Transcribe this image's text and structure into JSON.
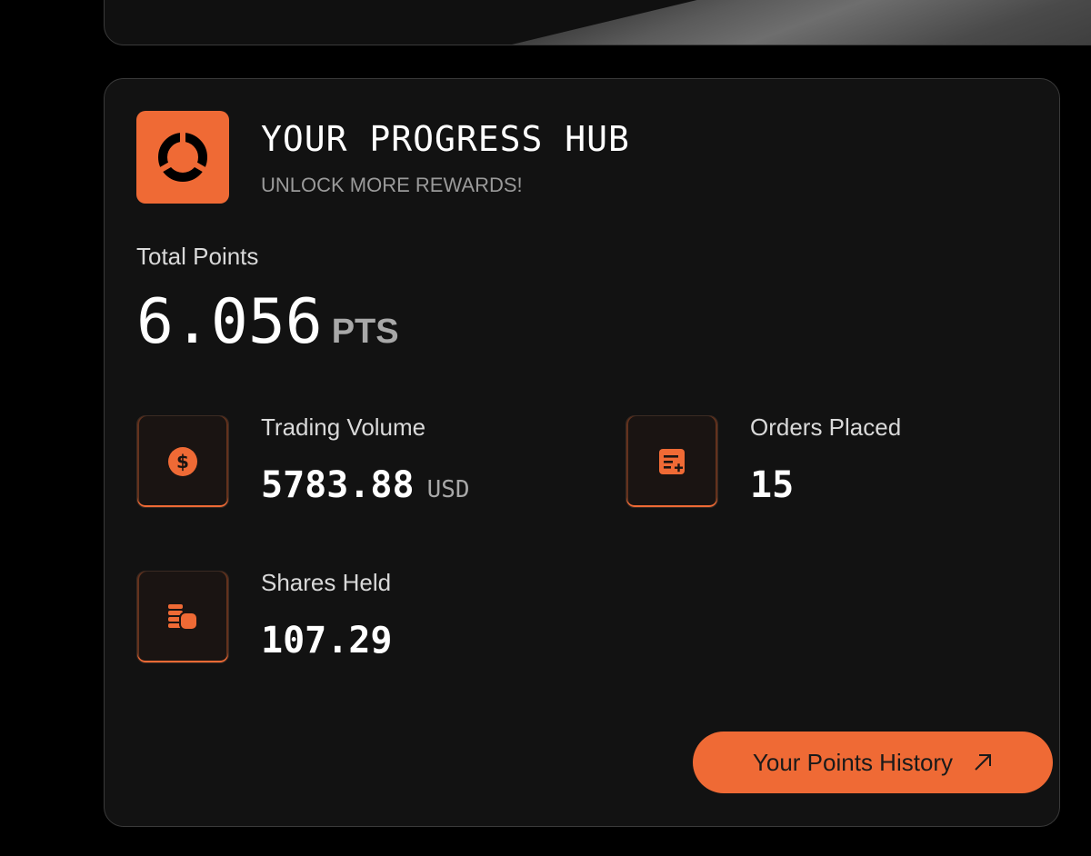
{
  "hub": {
    "title": "YOUR PROGRESS HUB",
    "subtitle": "UNLOCK MORE REWARDS!",
    "logo_icon": "segmented-circle-icon"
  },
  "total_points": {
    "label": "Total Points",
    "value": "6.056",
    "unit": "PTS"
  },
  "stats": {
    "trading_volume": {
      "label": "Trading Volume",
      "value": "5783.88",
      "unit": "USD",
      "icon": "dollar-coin-icon"
    },
    "orders_placed": {
      "label": "Orders Placed",
      "value": "15",
      "icon": "order-list-add-icon"
    },
    "shares_held": {
      "label": "Shares Held",
      "value": "107.29",
      "icon": "coin-stack-icon"
    }
  },
  "history_button": {
    "label": "Your Points History",
    "icon": "arrow-up-right-icon"
  },
  "colors": {
    "accent": "#ef6a35",
    "card_background": "#121212",
    "page_background": "#000000"
  }
}
